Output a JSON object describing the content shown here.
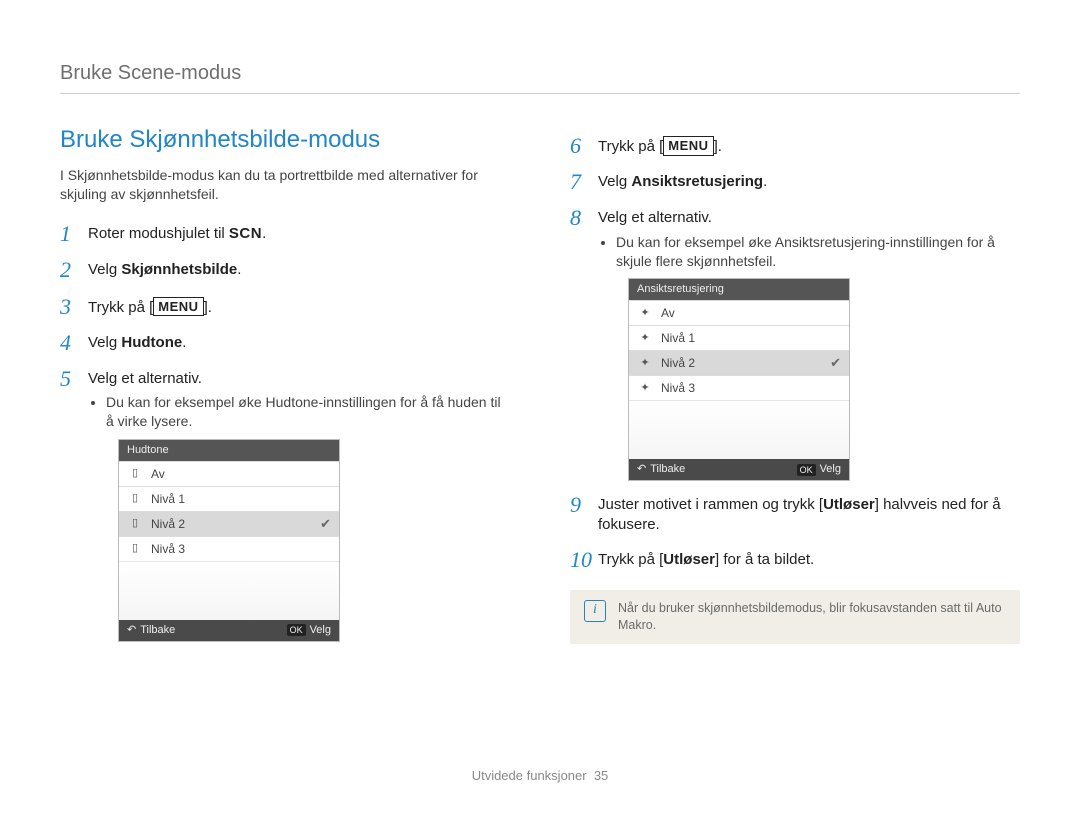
{
  "breadcrumb": "Bruke Scene-modus",
  "section_title": "Bruke Skjønnhetsbilde-modus",
  "intro": "I Skjønnhetsbilde-modus kan du ta portrettbilde med alternativer for skjuling av skjønnhetsfeil.",
  "steps": {
    "s1_pre": "Roter modushjulet til ",
    "s1_scn": "SCN",
    "s1_post": ".",
    "s2_pre": "Velg ",
    "s2_bold": "Skjønnhetsbilde",
    "s2_post": ".",
    "s3_pre": "Trykk på [",
    "s3_menu": "MENU",
    "s3_post": "].",
    "s4_pre": "Velg ",
    "s4_bold": "Hudtone",
    "s4_post": ".",
    "s5": "Velg et alternativ.",
    "s5_bullet": "Du kan for eksempel øke Hudtone-innstillingen for å få huden til å virke lysere.",
    "s6_pre": "Trykk på [",
    "s6_menu": "MENU",
    "s6_post": "].",
    "s7_pre": "Velg ",
    "s7_bold": "Ansiktsretusjering",
    "s7_post": ".",
    "s8": "Velg et alternativ.",
    "s8_bullet": "Du kan for eksempel øke Ansiktsretusjering-innstillingen for å skjule flere skjønnhetsfeil.",
    "s9_a": "Juster motivet i rammen og trykk [",
    "s9_bold": "Utløser",
    "s9_b": "] halvveis ned for å fokusere.",
    "s10_a": "Trykk på [",
    "s10_bold": "Utløser",
    "s10_b": "] for å ta bildet."
  },
  "camA": {
    "title": "Hudtone",
    "rows": [
      "Av",
      "Nivå 1",
      "Nivå 2",
      "Nivå 3"
    ],
    "selected_index": 2,
    "back": "Tilbake",
    "ok": "OK",
    "select": "Velg"
  },
  "camB": {
    "title": "Ansiktsretusjering",
    "rows": [
      "Av",
      "Nivå 1",
      "Nivå 2",
      "Nivå 3"
    ],
    "selected_index": 2,
    "back": "Tilbake",
    "ok": "OK",
    "select": "Velg"
  },
  "note": "Når du bruker skjønnhetsbildemodus, blir fokusavstanden satt til Auto Makro.",
  "footer_label": "Utvidede funksjoner",
  "footer_page": "35"
}
